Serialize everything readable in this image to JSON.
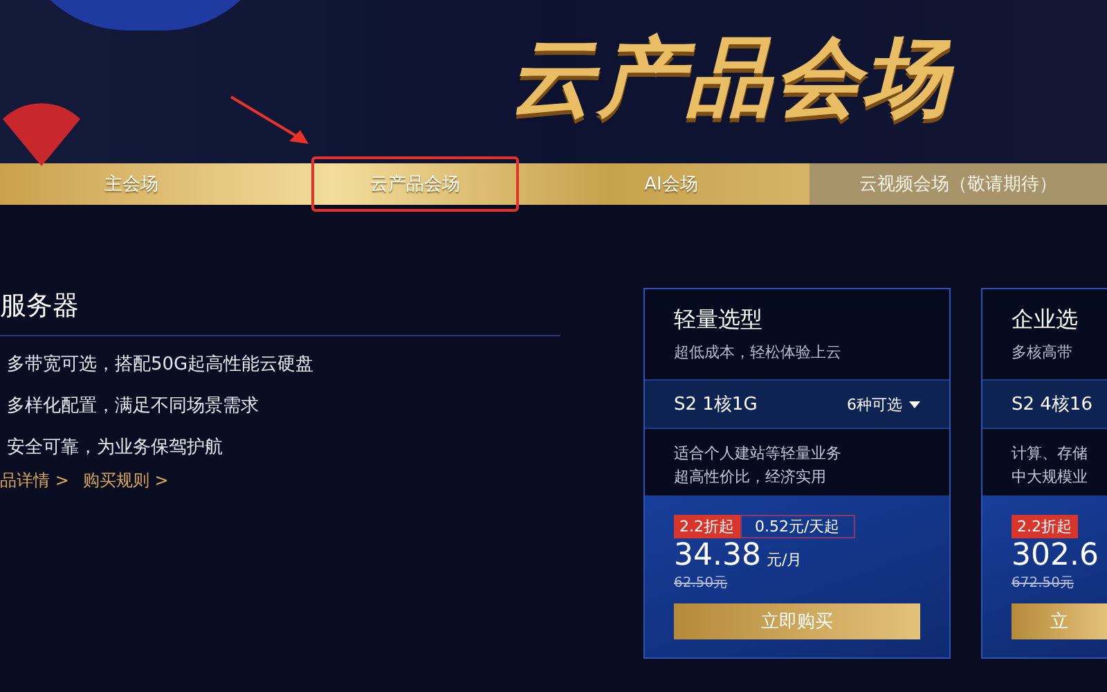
{
  "banner": {
    "title": "云产品会场"
  },
  "nav": {
    "tabs": [
      {
        "label": "主会场",
        "selected": false,
        "disabled": false
      },
      {
        "label": "云产品会场",
        "selected": true,
        "disabled": false
      },
      {
        "label": "AI会场",
        "selected": false,
        "disabled": false
      },
      {
        "label": "云视频会场（敬请期待）",
        "selected": false,
        "disabled": true
      }
    ]
  },
  "intro": {
    "title": "服务器",
    "features": [
      "多带宽可选，搭配50G起高性能云硬盘",
      "多样化配置，满足不同场景需求",
      "安全可靠，为业务保驾护航"
    ],
    "links": [
      "品详情 >",
      "购买规则 >"
    ]
  },
  "cards": [
    {
      "title": "轻量选型",
      "subtitle": "超低成本，轻松体验上云",
      "spec": "S2 1核1G",
      "options": "6种可选",
      "description": [
        "适合个人建站等轻量业务",
        "超高性价比，经济实用"
      ],
      "discount": "2.2折起",
      "per_day": "0.52元/天起",
      "price": "34.38",
      "unit": "元/月",
      "original_price": "62.50元",
      "button": "立即购买"
    },
    {
      "title": "企业选",
      "subtitle": "多核高带",
      "spec": "S2 4核16",
      "description": [
        "计算、存储",
        "中大规模业"
      ],
      "discount": "2.2折起",
      "price": "302.6",
      "original_price": "672.50元",
      "button": "立"
    }
  ]
}
